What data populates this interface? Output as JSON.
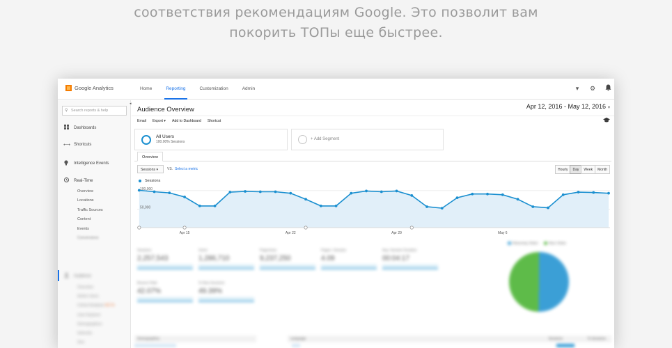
{
  "hero": {
    "line1": "соответствия рекомендациям Google. Это позволит вам",
    "line2": "покорить ТОПы еще быстрее."
  },
  "app": {
    "logo_text": "Google Analytics",
    "nav": [
      {
        "label": "Home",
        "active": false
      },
      {
        "label": "Reporting",
        "active": true
      },
      {
        "label": "Customization",
        "active": false
      },
      {
        "label": "Admin",
        "active": false
      }
    ],
    "top_icons": [
      "caret-down-icon",
      "gear-icon",
      "bell-icon"
    ]
  },
  "sidebar": {
    "search_placeholder": "Search reports & help",
    "items": [
      {
        "label": "Dashboards",
        "icon": "grid-icon"
      },
      {
        "label": "Shortcuts",
        "icon": "arrows-icon"
      },
      {
        "label": "Intelligence Events",
        "icon": "bulb-icon"
      },
      {
        "label": "Real-Time",
        "icon": "clock-icon"
      }
    ],
    "realtime_sub": [
      "Overview",
      "Locations",
      "Traffic Sources",
      "Content",
      "Events",
      "Conversions"
    ],
    "audience_label": "Audience",
    "audience_sub": [
      "Overview",
      "Active Users",
      "Cohort Analysis",
      "User Explorer",
      "Demographics",
      "Interests",
      "Geo",
      "Behavior"
    ],
    "beta_badge": "BETA"
  },
  "report": {
    "title": "Audience Overview",
    "date_range": "Apr 12, 2016 - May 12, 2016",
    "actions": [
      "Email",
      "Export ▾",
      "Add to Dashboard",
      "Shortcut"
    ],
    "segment": {
      "title": "All Users",
      "subtitle": "100.00% Sessions",
      "add_label": "+ Add Segment"
    },
    "tab": "Overview",
    "metric_select": "Sessions",
    "vs": "VS.",
    "select_metric": "Select a metric",
    "time_buttons": [
      {
        "label": "Hourly",
        "active": false
      },
      {
        "label": "Day",
        "active": true
      },
      {
        "label": "Week",
        "active": false
      },
      {
        "label": "Month",
        "active": false
      }
    ]
  },
  "chart_data": {
    "type": "area",
    "series": [
      {
        "name": "Sessions",
        "values": [
          100000,
          96000,
          93000,
          82000,
          58000,
          58000,
          95000,
          97000,
          96000,
          96000,
          92000,
          76000,
          58000,
          58000,
          92000,
          98000,
          96000,
          98000,
          86000,
          56000,
          52000,
          80000,
          90000,
          90000,
          88000,
          76000,
          56000,
          53000,
          88000,
          95000,
          94000,
          92000
        ]
      }
    ],
    "x_tick_labels": [
      "Apr 15",
      "Apr 22",
      "Apr 29",
      "May 6"
    ],
    "x_tick_indices": [
      3,
      10,
      17,
      24
    ],
    "y_tick_labels": [
      "100,000",
      "50,000"
    ],
    "ylim": [
      0,
      110000
    ],
    "annotation_indices": [
      0,
      3,
      11,
      18
    ],
    "line_color": "#1a8fd0",
    "fill_color": "#e1eff9"
  },
  "summary_metrics": [
    {
      "label": "Sessions",
      "value": "2,257,543"
    },
    {
      "label": "Users",
      "value": "1,286,710"
    },
    {
      "label": "Pageviews",
      "value": "9,237,250"
    },
    {
      "label": "Pages / Session",
      "value": "4.09"
    },
    {
      "label": "Avg. Session Duration",
      "value": "00:04:17"
    },
    {
      "label": "Bounce Rate",
      "value": "42.07%"
    },
    {
      "label": "% New Sessions",
      "value": "49.39%"
    }
  ],
  "pie": {
    "legend": [
      {
        "label": "Returning Visitor",
        "color": "#1a8fd0"
      },
      {
        "label": "New Visitor",
        "color": "#43b02a"
      }
    ],
    "values": [
      50.3,
      49.7
    ]
  },
  "bottom_table": {
    "left_header": "Demographics",
    "right_header": "Language",
    "right_cols": [
      "Sessions",
      "% Sessions"
    ]
  }
}
